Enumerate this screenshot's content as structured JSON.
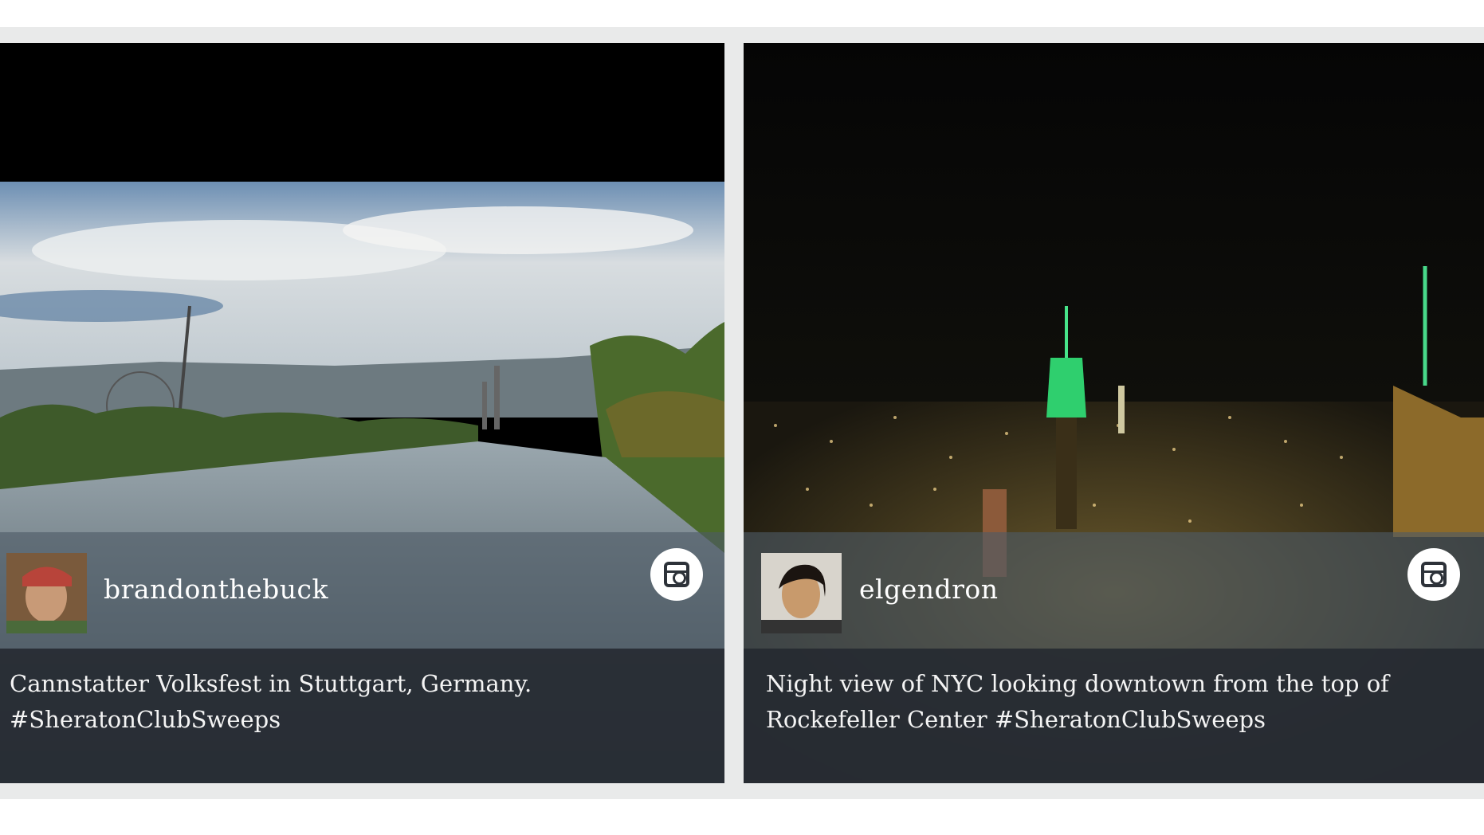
{
  "posts": [
    {
      "username": "brandonthebuck",
      "caption": "Cannstatter Volksfest in Stuttgart, Germany. #SheratonClubSweeps",
      "network_icon": "instagram-icon",
      "scene": "river landscape with ferris wheel and smokestacks"
    },
    {
      "username": "elgendron",
      "caption": "Night view of NYC looking downtown from the top of Rockefeller Center #SheratonClubSweeps",
      "network_icon": "instagram-icon",
      "scene": "night city skyline with green-lit towers"
    }
  ],
  "colors": {
    "strip": "#e9eaea",
    "user_bar": "#4e5a66",
    "caption_bar": "#282d34",
    "accent_green": "#3ddc74"
  }
}
